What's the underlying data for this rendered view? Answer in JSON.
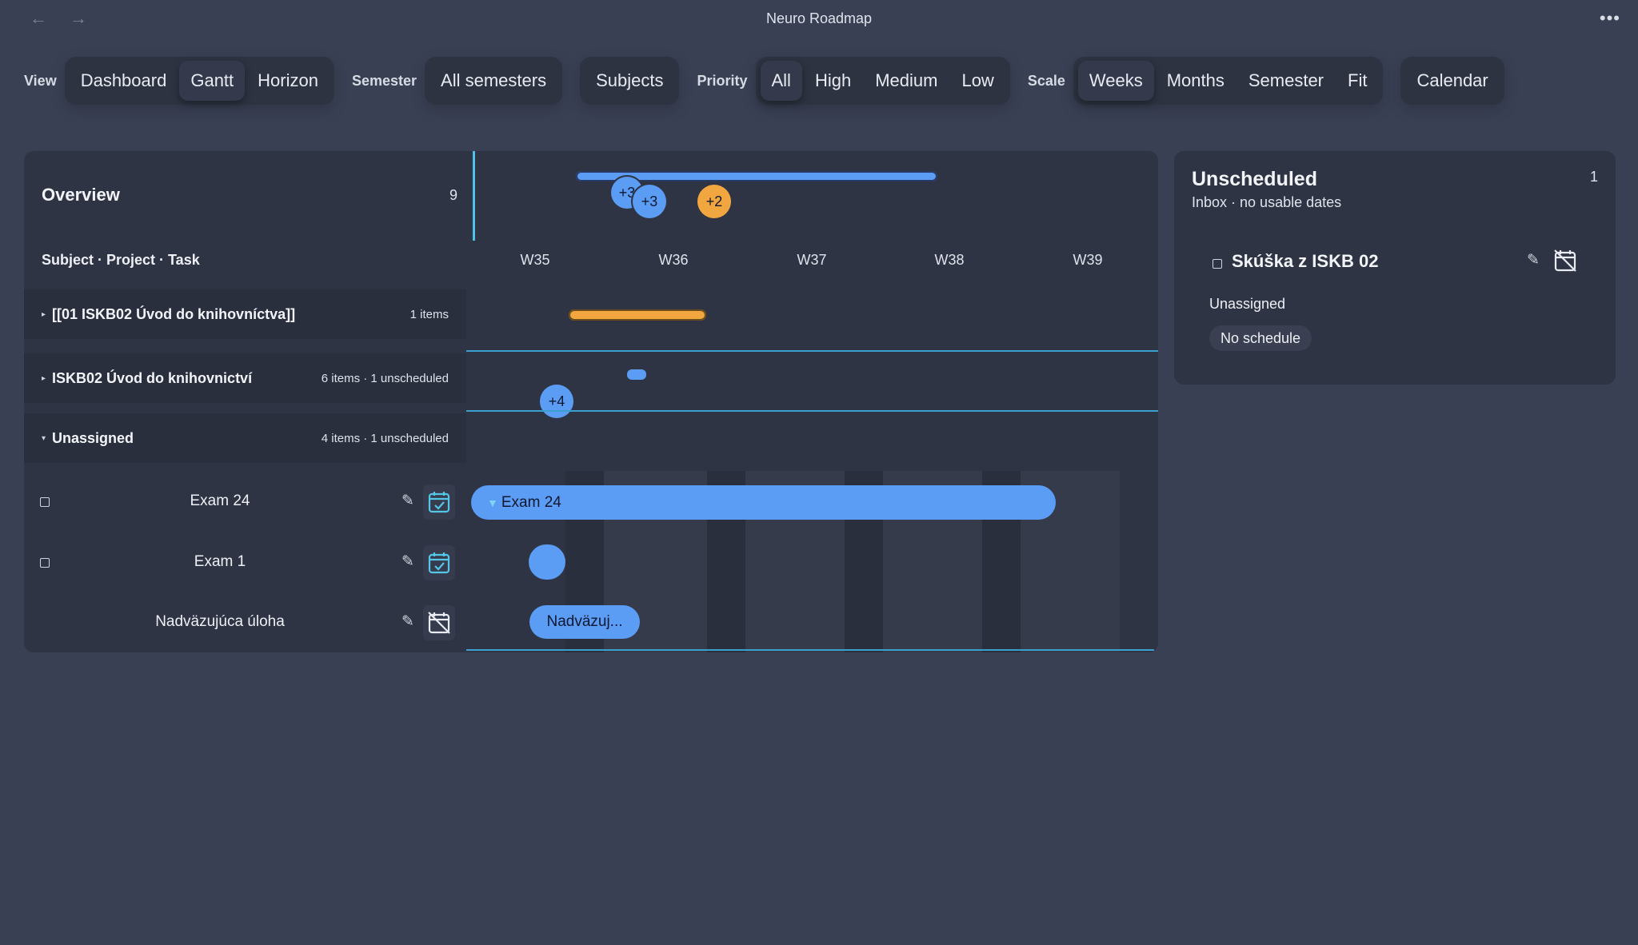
{
  "window": {
    "title": "Neuro Roadmap",
    "back_icon": "←",
    "forward_icon": "→",
    "more_icon": "•••"
  },
  "toolbar": {
    "view_label": "View",
    "views": [
      "Dashboard",
      "Gantt",
      "Horizon"
    ],
    "semester_label": "Semester",
    "semester_value": "All semesters",
    "subjects_label": "Subjects",
    "priority_label": "Priority",
    "priorities": [
      "All",
      "High",
      "Medium",
      "Low"
    ],
    "scale_label": "Scale",
    "scales": [
      "Weeks",
      "Months",
      "Semester",
      "Fit"
    ],
    "calendar_label": "Calendar"
  },
  "gantt": {
    "overview_title": "Overview",
    "overview_count": "9",
    "column_label": "Subject · Project · Task",
    "weeks": [
      "W35",
      "W36",
      "W37",
      "W38",
      "W39"
    ],
    "overview_badges": [
      "+3",
      "+3",
      "+2"
    ],
    "groups": [
      {
        "tri": "▸",
        "name": "[[01 ISKB02 Úvod do knihovníctva]]",
        "meta": "1 items"
      },
      {
        "tri": "▸",
        "name": "ISKB02 Úvod do knihovnictví",
        "meta": "6 items · 1 unscheduled",
        "badge": "+4"
      },
      {
        "tri": "▾",
        "name": "Unassigned",
        "meta": "4 items · 1 unscheduled"
      }
    ],
    "tasks": [
      {
        "name": "Exam 24",
        "bar_label": "Exam 24",
        "bar_marker": "▼"
      },
      {
        "name": "Exam 1"
      },
      {
        "name": "Nadväzujúca úloha",
        "bar_label": "Nadväzuj..."
      }
    ],
    "pencil_icon": "✎"
  },
  "unscheduled": {
    "title": "Unscheduled",
    "subtitle": "Inbox · no usable dates",
    "count": "1",
    "item_name": "Skúška z ISKB 02",
    "assignee": "Unassigned",
    "schedule": "No schedule"
  },
  "colors": {
    "background": "#3a4054",
    "panel": "#2f3444",
    "accent_blue": "#5b9cf5",
    "accent_orange": "#f2a640",
    "calendar_cyan": "#54c6e8",
    "row_line": "#3b9fd0"
  }
}
